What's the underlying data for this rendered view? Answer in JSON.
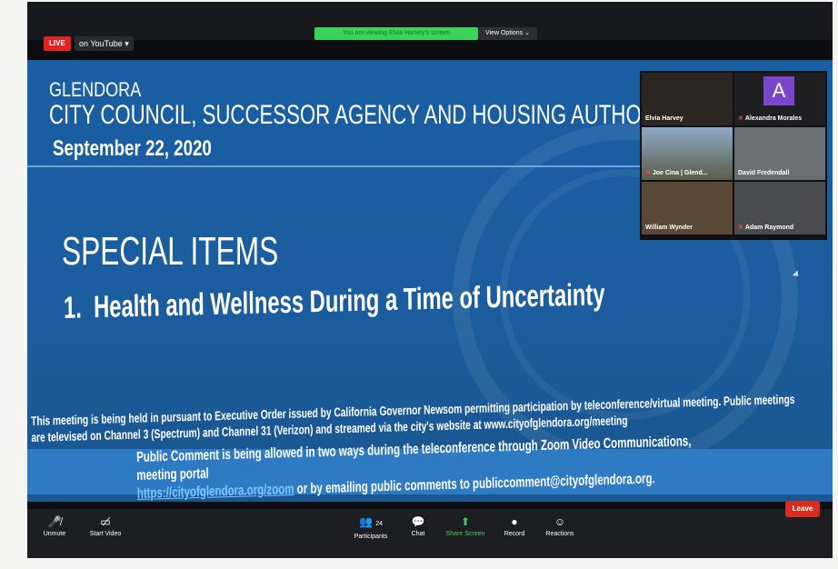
{
  "topbar": {
    "live": "LIVE",
    "stream": "on YouTube",
    "viewing": "You are viewing Elvia Harvey's screen",
    "view_options": "View Options"
  },
  "slide": {
    "city": "GLENDORA",
    "council": "CITY COUNCIL, SUCCESSOR AGENCY AND HOUSING AUTHORITY",
    "date": "September 22, 2020",
    "section": "SPECIAL ITEMS",
    "item_number": "1.",
    "item_text": "Health and Wellness During a Time of Uncertainty",
    "notice_1": "This meeting is being held in pursuant to Executive Order issued by California Governor Newsom permitting participation by teleconference/virtual meeting. Public meetings",
    "notice_2": "are televised on Channel 3 (Spectrum) and Channel 31 (Verizon) and streamed via the city's website at www.cityofglendora.org/meeting",
    "pc_1": "Public Comment is being allowed in two ways during the teleconference through Zoom Video Communications, meeting portal",
    "pc_link": "https://cityofglendora.org/zoom",
    "pc_2": "or by emailing public comments to publiccomment@cityofglendora.org."
  },
  "participants_avatar": "A",
  "participants": [
    "Elvia Harvey",
    "Alexandra Morales",
    "Joe Cina | Glend...",
    "David Fredendall",
    "William Wynder",
    "Adam Raymond"
  ],
  "controls": {
    "unmute": "Unmute",
    "start_video": "Start Video",
    "participant_count": "24",
    "participants": "Participants",
    "chat": "Chat",
    "share": "Share Screen",
    "record": "Record",
    "reactions": "Reactions",
    "leave": "Leave"
  }
}
